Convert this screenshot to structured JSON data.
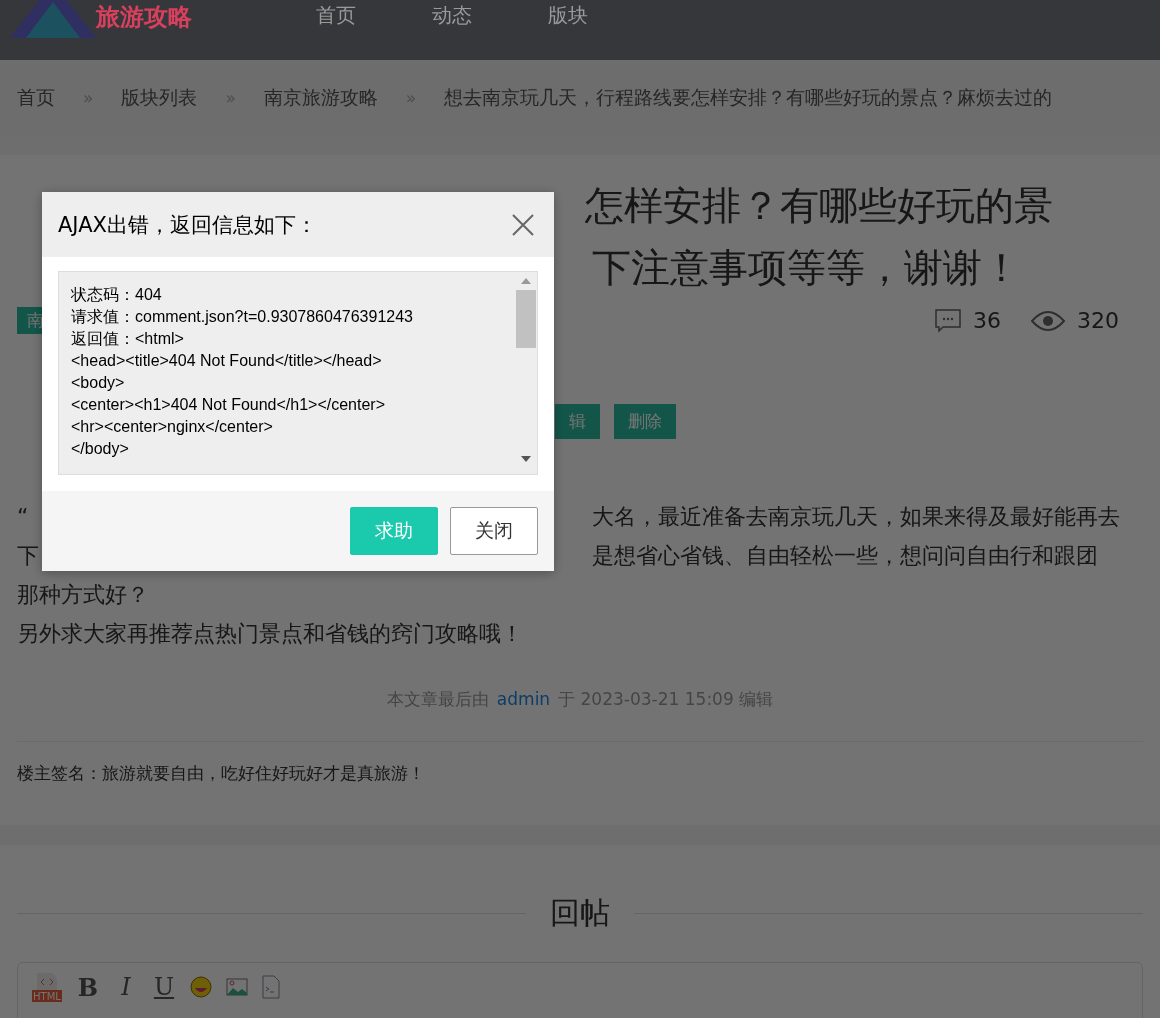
{
  "header": {
    "logo_text": "旅游攻略",
    "nav": [
      "首页",
      "动态",
      "版块"
    ]
  },
  "breadcrumb": [
    "首页",
    "版块列表",
    "南京旅游攻略",
    "想去南京玩几天，行程路线要怎样安排？有哪些好玩的景点？麻烦去过的"
  ],
  "breadcrumb_separator": "»",
  "post": {
    "title_lines": [
      {
        "right": "怎样安排？有哪些好玩的景"
      },
      {
        "right": "下注意事项等等，谢谢！"
      }
    ],
    "tag": "南",
    "comments": "36",
    "views": "320",
    "actions": [
      "辑",
      "删除"
    ],
    "body_lines": [
      {
        "left": "“",
        "right": "大名，最近准备去南京玩几天，如果来得及最好能再去"
      },
      {
        "left": "下",
        "right": "是想省心省钱、自由轻松一些，想问问自由行和跟团"
      },
      {
        "left": "那种方式好？"
      },
      {
        "left": "另外求大家再推荐点热门景点和省钱的窍门攻略哦！"
      }
    ],
    "edit_note": {
      "before": "本文章最后由",
      "user": "admin",
      "after": "于 2023-03-21 15:09 编辑"
    },
    "signature": "楼主签名：旅游就要自由，吃好住好玩好才是真旅游！"
  },
  "reply": {
    "heading": "回帖",
    "toolbar": [
      {
        "kind": "html",
        "label": "HTML"
      },
      {
        "kind": "bold",
        "label": "B"
      },
      {
        "kind": "italic",
        "label": "I"
      },
      {
        "kind": "underline",
        "label": "U"
      },
      {
        "kind": "emoji"
      },
      {
        "kind": "image"
      },
      {
        "kind": "code"
      }
    ]
  },
  "dialog": {
    "title": "AJAX出错，返回信息如下：",
    "output_lines": [
      "状态码：404",
      "请求值：comment.json?t=0.9307860476391243",
      "返回值：<html>",
      "<head><title>404 Not Found</title></head>",
      "<body>",
      "<center><h1>404 Not Found</h1></center>",
      "<hr><center>nginx</center>",
      "</body>"
    ],
    "buttons": [
      {
        "label": "求助",
        "kind": "primary"
      },
      {
        "label": "关闭",
        "kind": "default"
      }
    ]
  }
}
